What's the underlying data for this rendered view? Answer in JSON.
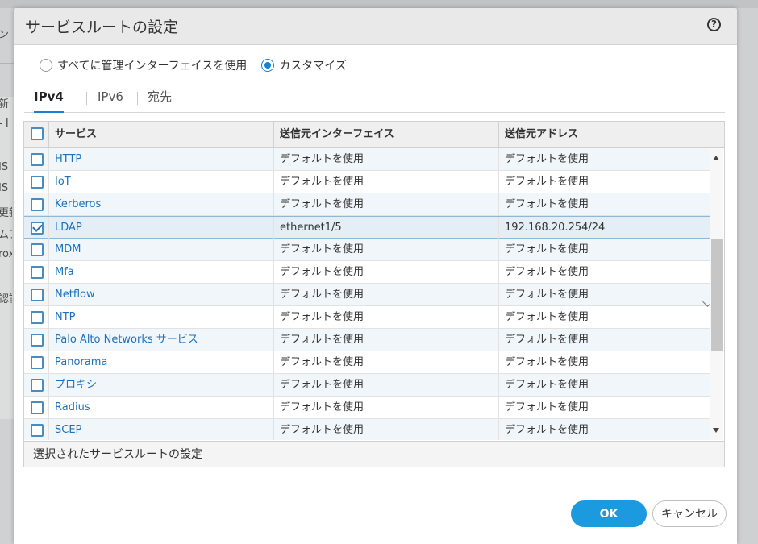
{
  "background": {
    "fragments": [
      "ン",
      "新",
      "- I",
      "IS",
      "IS",
      "更新",
      "ムア",
      "rox",
      "—",
      "認証",
      "—"
    ]
  },
  "dialog": {
    "title": "サービスルートの設定",
    "help_icon": "question-icon",
    "radio_options": [
      {
        "label": "すべてに管理インターフェイスを使用",
        "checked": false
      },
      {
        "label": "カスタマイズ",
        "checked": true
      }
    ],
    "tabs": [
      "IPv4",
      "IPv6",
      "宛先"
    ],
    "active_tab": "IPv4",
    "table": {
      "headers": [
        "サービス",
        "送信元インターフェイス",
        "送信元アドレス"
      ],
      "rows": [
        {
          "service": "HTTP",
          "interface": "デフォルトを使用",
          "address": "デフォルトを使用",
          "checked": false
        },
        {
          "service": "IoT",
          "interface": "デフォルトを使用",
          "address": "デフォルトを使用",
          "checked": false
        },
        {
          "service": "Kerberos",
          "interface": "デフォルトを使用",
          "address": "デフォルトを使用",
          "checked": false
        },
        {
          "service": "LDAP",
          "interface": "ethernet1/5",
          "address": "192.168.20.254/24",
          "checked": true
        },
        {
          "service": "MDM",
          "interface": "デフォルトを使用",
          "address": "デフォルトを使用",
          "checked": false
        },
        {
          "service": "Mfa",
          "interface": "デフォルトを使用",
          "address": "デフォルトを使用",
          "checked": false
        },
        {
          "service": "Netflow",
          "interface": "デフォルトを使用",
          "address": "デフォルトを使用",
          "checked": false
        },
        {
          "service": "NTP",
          "interface": "デフォルトを使用",
          "address": "デフォルトを使用",
          "checked": false
        },
        {
          "service": "Palo Alto Networks サービス",
          "interface": "デフォルトを使用",
          "address": "デフォルトを使用",
          "checked": false
        },
        {
          "service": "Panorama",
          "interface": "デフォルトを使用",
          "address": "デフォルトを使用",
          "checked": false
        },
        {
          "service": "プロキシ",
          "interface": "デフォルトを使用",
          "address": "デフォルトを使用",
          "checked": false
        },
        {
          "service": "Radius",
          "interface": "デフォルトを使用",
          "address": "デフォルトを使用",
          "checked": false
        },
        {
          "service": "SCEP",
          "interface": "デフォルトを使用",
          "address": "デフォルトを使用",
          "checked": false
        }
      ],
      "footer": "選択されたサービスルートの設定"
    },
    "buttons": {
      "ok": "OK",
      "cancel": "キャンセル"
    },
    "colors": {
      "accent": "#1b9ae0",
      "link": "#1b72c0"
    }
  }
}
